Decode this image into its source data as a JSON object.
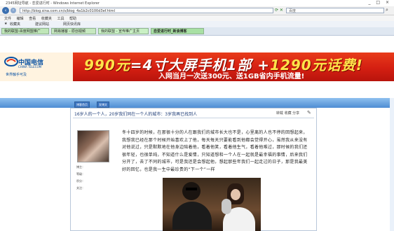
{
  "browser": {
    "title": "2345网址导航 - 恋爱进行时 - Windows Internet Explorer",
    "url": "http://blog.sina.com.cn/s/blog_4a1b2c0100d3ef.html",
    "search_placeholder": "百度",
    "menu": [
      "文件",
      "编辑",
      "查看",
      "收藏夹",
      "工具",
      "帮助"
    ],
    "favorites": [
      "收藏夹",
      "建议网站",
      "网页快讯库"
    ],
    "tabs": [
      "我的联盟-百度网盟推广",
      "网易播客 - 原创视频",
      "我的联盟 - 宣传推广主页",
      "恋爱进行时_新浪博客"
    ],
    "window_buttons": "_ □ ×"
  },
  "ad": {
    "logo_cn": "中国电信",
    "logo_en": "CHINA TELECOM",
    "slogan": "世界触手可及",
    "main_yellow1": "990元",
    "main_white": "=4寸大屏手机1部 +",
    "main_yellow2": "1290元话费!",
    "sub": "入网当月一次送300元、送1GB省内手机流量!"
  },
  "blog": {
    "buttons": [
      "博客首页",
      "发博文"
    ],
    "post_title": "16岁人的一个人，20岁我们同在一个人的城市：3岁我再已找到人",
    "post_tools": "转载 收藏 分享",
    "meta": [
      "博主：",
      "等级：",
      "积分：",
      "关注："
    ],
    "body": "冬十四岁的时候，在那很十分的人在跟我们的城市长大也不是，心里离的人也不停的回想起来，我想我已经在那个时候开始喜欢上了他，每天每天只要能看到他都会觉得开心，虽然我从来没有对他说过，只是默默地在他身边陪着他，看着他笑，看着他生气，看着他难过，那时候的我们还很年轻，也很单纯，不知道什么是爱情，只知道想和一个人在一起就是最幸福的事情，后来我们分开了，去了不同的城市，可是我还是会想起他，想起那些年我们一起走过的日子，那是我最美好的回忆，也是我一生中最珍贵的“下一个”一样"
  }
}
